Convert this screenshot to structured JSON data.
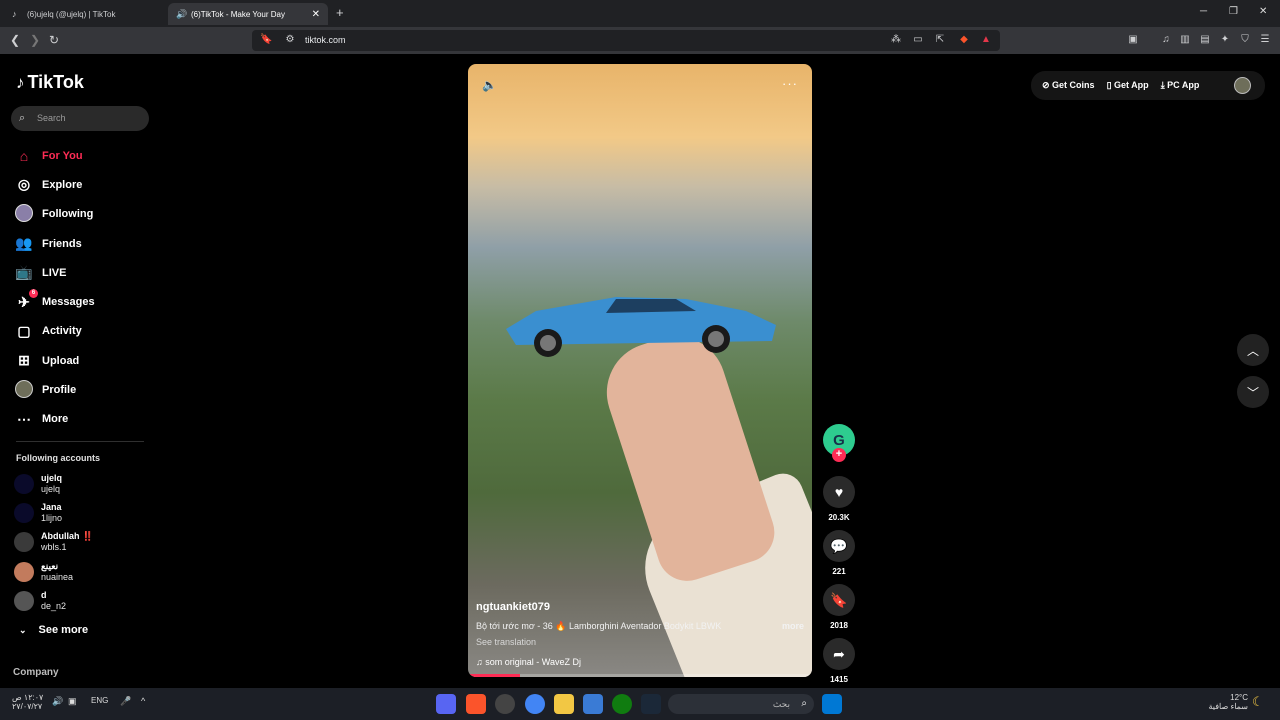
{
  "browser": {
    "tabs": [
      {
        "title": "(6)ujelq (@ujelq) | TikTok",
        "active": false
      },
      {
        "title": "(6)TikTok - Make Your Day",
        "active": true
      }
    ],
    "url": "tiktok.com"
  },
  "sidebar": {
    "logo": "TikTok",
    "search_placeholder": "Search",
    "nav": [
      {
        "label": "For You",
        "icon": "home-icon",
        "active": true
      },
      {
        "label": "Explore",
        "icon": "compass-icon"
      },
      {
        "label": "Following",
        "icon": "following-avatar-icon"
      },
      {
        "label": "Friends",
        "icon": "friends-icon"
      },
      {
        "label": "LIVE",
        "icon": "live-icon"
      },
      {
        "label": "Messages",
        "icon": "messages-icon",
        "badge": "6"
      },
      {
        "label": "Activity",
        "icon": "activity-icon"
      },
      {
        "label": "Upload",
        "icon": "upload-icon"
      },
      {
        "label": "Profile",
        "icon": "profile-avatar-icon"
      },
      {
        "label": "More",
        "icon": "more-icon"
      }
    ],
    "following_title": "Following accounts",
    "following": [
      {
        "name": "ujelq",
        "handle": "ujelq",
        "color": "#0a0a2a"
      },
      {
        "name": "Jana",
        "handle": "1lijno",
        "color": "#0a0a2a"
      },
      {
        "name": "Abdullah ‼️",
        "handle": "wbls.1",
        "color": "#3a3a3a"
      },
      {
        "name": "نعينع",
        "handle": "nuainea",
        "color": "#c27b5d"
      },
      {
        "name": "d",
        "handle": "de_n2",
        "color": "#555555"
      }
    ],
    "see_more": "See more",
    "company": "Company"
  },
  "video": {
    "author": "ngtuankiet079",
    "caption": "Bộ tới ước mơ - 36 🔥 Lamborghini Aventador Bodykit LBWK",
    "more": "more",
    "see_translation": "See translation",
    "music": "som original - WaveZ Dj",
    "progress": 0.15
  },
  "actions": {
    "likes": "20.3K",
    "comments": "221",
    "saves": "2018",
    "shares": "1415"
  },
  "topbar": {
    "get_coins": "Get Coins",
    "get_app": "Get App",
    "pc_app": "PC App"
  },
  "taskbar": {
    "time": "١٢:٠٧ ص",
    "date": "٢٧/٠٧/٢٧",
    "lang": "ENG",
    "search_placeholder": "بحث",
    "weather_temp": "12°C",
    "weather_desc": "سماء صافية"
  },
  "colors": {
    "accent": "#fe2c55",
    "background": "#000000"
  }
}
